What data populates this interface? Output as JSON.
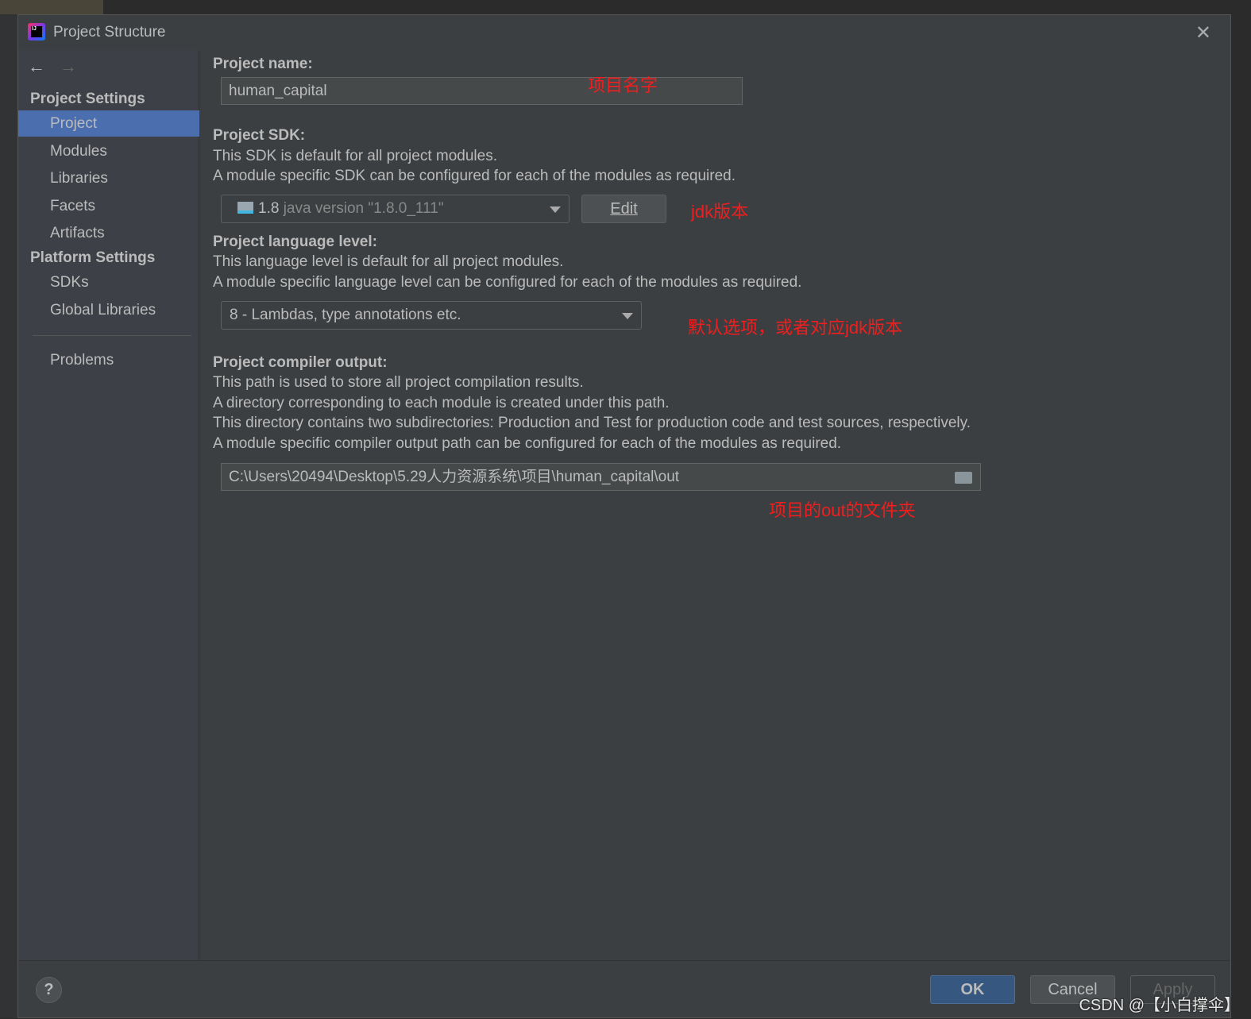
{
  "window": {
    "title": "Project Structure",
    "close_icon": "close-icon"
  },
  "sidebar": {
    "back": "←",
    "forward": "→",
    "sections": [
      {
        "label": "Project Settings"
      },
      {
        "label": "Platform Settings"
      }
    ],
    "items": [
      {
        "label": "Project",
        "selected": true
      },
      {
        "label": "Modules"
      },
      {
        "label": "Libraries"
      },
      {
        "label": "Facets"
      },
      {
        "label": "Artifacts"
      },
      {
        "label": "SDKs"
      },
      {
        "label": "Global Libraries"
      },
      {
        "label": "Problems"
      }
    ]
  },
  "main": {
    "name_label": "Project name:",
    "name_value": "human_capital",
    "sdk_label": "Project SDK:",
    "sdk_desc1": "This SDK is default for all project modules.",
    "sdk_desc2": "A module specific SDK can be configured for each of the modules as required.",
    "sdk_version": "1.8",
    "sdk_detail": "java version \"1.8.0_111\"",
    "edit_label": "Edit",
    "lang_label": "Project language level:",
    "lang_desc1": "This language level is default for all project modules.",
    "lang_desc2": "A module specific language level can be configured for each of the modules as required.",
    "lang_value": "8 - Lambdas, type annotations etc.",
    "out_label": "Project compiler output:",
    "out_desc1": "This path is used to store all project compilation results.",
    "out_desc2": "A directory corresponding to each module is created under this path.",
    "out_desc3": "This directory contains two subdirectories: Production and Test for production code and test sources, respectively.",
    "out_desc4": "A module specific compiler output path can be configured for each of the modules as required.",
    "out_value": "C:\\Users\\20494\\Desktop\\5.29人力资源系统\\项目\\human_capital\\out"
  },
  "annotations": {
    "name": "项目名字",
    "sdk": "jdk版本",
    "lang": "默认选项，或者对应jdk版本",
    "out": "项目的out的文件夹"
  },
  "footer": {
    "help": "?",
    "ok": "OK",
    "cancel": "Cancel",
    "apply": "Apply"
  },
  "watermark": "CSDN @【小白撑伞】",
  "colors": {
    "selection": "#4b6eaf",
    "annotation": "#f01e1e",
    "ok_button": "#365880"
  }
}
